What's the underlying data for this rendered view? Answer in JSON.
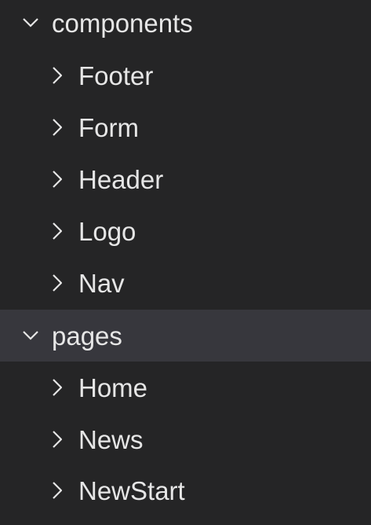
{
  "explorer": {
    "folders": [
      {
        "name": "components",
        "expanded": true,
        "selected": false,
        "toggle_icon": "chevron-down-icon",
        "children": [
          {
            "name": "Footer",
            "toggle_icon": "chevron-right-icon"
          },
          {
            "name": "Form",
            "toggle_icon": "chevron-right-icon"
          },
          {
            "name": "Header",
            "toggle_icon": "chevron-right-icon"
          },
          {
            "name": "Logo",
            "toggle_icon": "chevron-right-icon"
          },
          {
            "name": "Nav",
            "toggle_icon": "chevron-right-icon"
          }
        ]
      },
      {
        "name": "pages",
        "expanded": true,
        "selected": true,
        "toggle_icon": "chevron-down-icon",
        "children": [
          {
            "name": "Home",
            "toggle_icon": "chevron-right-icon"
          },
          {
            "name": "News",
            "toggle_icon": "chevron-right-icon"
          },
          {
            "name": "NewStart",
            "toggle_icon": "chevron-right-icon"
          }
        ]
      }
    ]
  },
  "colors": {
    "background": "#252526",
    "selected_row": "#37373d",
    "text": "#e6e6e6"
  }
}
